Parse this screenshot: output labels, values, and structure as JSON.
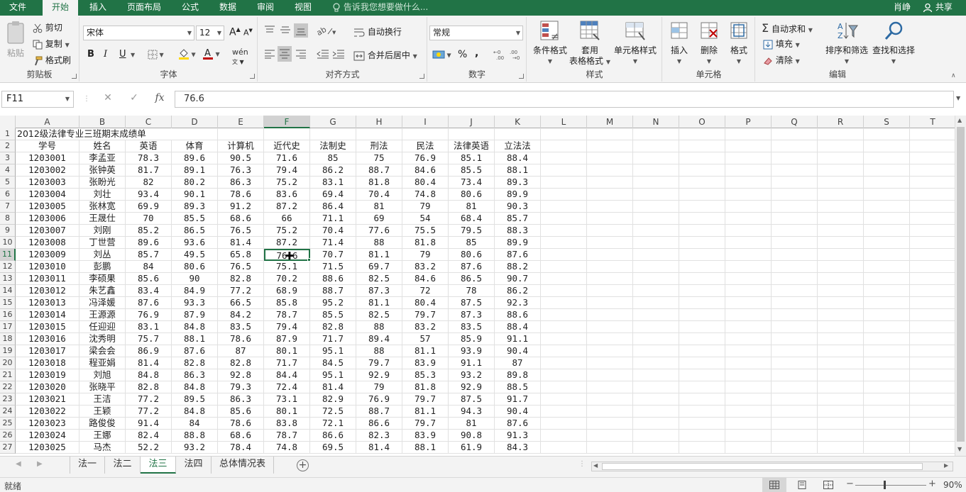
{
  "menu": {
    "tabs": [
      "文件",
      "开始",
      "插入",
      "页面布局",
      "公式",
      "数据",
      "审阅",
      "视图"
    ],
    "active": "开始",
    "tell_me": "告诉我您想要做什么...",
    "user": "肖峥",
    "share": "共享"
  },
  "ribbon": {
    "clipboard": {
      "paste": "粘贴",
      "cut": "剪切",
      "copy": "复制",
      "format_painter": "格式刷",
      "label": "剪贴板"
    },
    "font": {
      "name": "宋体",
      "size": "12",
      "label": "字体",
      "bold": "B",
      "italic": "I",
      "underline": "U",
      "grow": "A",
      "shrink": "A"
    },
    "alignment": {
      "wrap": "自动换行",
      "merge": "合并后居中",
      "label": "对齐方式"
    },
    "number": {
      "format": "常规",
      "label": "数字",
      "percent": "%",
      "comma": ","
    },
    "styles": {
      "conditional": "条件格式",
      "table_fmt_1": "套用",
      "table_fmt_2": "表格格式",
      "cell_styles": "单元格样式",
      "label": "样式"
    },
    "cells": {
      "insert": "插入",
      "delete": "删除",
      "format": "格式",
      "label": "单元格"
    },
    "editing": {
      "autosum": "自动求和",
      "fill": "填充",
      "clear": "清除",
      "sort": "排序和筛选",
      "find": "查找和选择",
      "label": "编辑"
    }
  },
  "formula_bar": {
    "name_box": "F11",
    "formula": "76.6",
    "fx": "fx"
  },
  "columns": [
    "A",
    "B",
    "C",
    "D",
    "E",
    "F",
    "G",
    "H",
    "I",
    "J",
    "K",
    "L",
    "M",
    "N",
    "O",
    "P",
    "Q",
    "R",
    "S",
    "T"
  ],
  "selected": {
    "col": "F",
    "row": 11
  },
  "sheet": {
    "title": "2012级法律专业三班期末成绩单",
    "headers": [
      "学号",
      "姓名",
      "英语",
      "体育",
      "计算机",
      "近代史",
      "法制史",
      "刑法",
      "民法",
      "法律英语",
      "立法法"
    ],
    "rows": [
      [
        "1203001",
        "李孟亚",
        "78.3",
        "89.6",
        "90.5",
        "71.6",
        "85",
        "75",
        "76.9",
        "85.1",
        "88.4"
      ],
      [
        "1203002",
        "张钟英",
        "81.7",
        "89.1",
        "76.3",
        "79.4",
        "86.2",
        "88.7",
        "84.6",
        "85.5",
        "88.1"
      ],
      [
        "1203003",
        "张盼光",
        "82",
        "80.2",
        "86.3",
        "75.2",
        "83.1",
        "81.8",
        "80.4",
        "73.4",
        "89.3"
      ],
      [
        "1203004",
        "刘壮",
        "93.4",
        "90.1",
        "78.6",
        "83.6",
        "69.4",
        "70.4",
        "74.8",
        "80.6",
        "89.9"
      ],
      [
        "1203005",
        "张林宽",
        "69.9",
        "89.3",
        "91.2",
        "87.2",
        "86.4",
        "81",
        "79",
        "81",
        "90.3"
      ],
      [
        "1203006",
        "王晟仕",
        "70",
        "85.5",
        "68.6",
        "66",
        "71.1",
        "69",
        "54",
        "68.4",
        "85.7"
      ],
      [
        "1203007",
        "刘刚",
        "85.2",
        "86.5",
        "76.5",
        "75.2",
        "70.4",
        "77.6",
        "75.5",
        "79.5",
        "88.3"
      ],
      [
        "1203008",
        "丁世营",
        "89.6",
        "93.6",
        "81.4",
        "87.2",
        "71.4",
        "88",
        "81.8",
        "85",
        "89.9"
      ],
      [
        "1203009",
        "刘丛",
        "85.7",
        "49.5",
        "65.8",
        "76.6",
        "70.7",
        "81.1",
        "79",
        "80.6",
        "87.6"
      ],
      [
        "1203010",
        "彭鹏",
        "84",
        "80.6",
        "76.5",
        "75.1",
        "71.5",
        "69.7",
        "83.2",
        "87.6",
        "88.2"
      ],
      [
        "1203011",
        "李硕果",
        "85.6",
        "90",
        "82.8",
        "70.2",
        "88.6",
        "82.5",
        "84.6",
        "86.5",
        "90.7"
      ],
      [
        "1203012",
        "朱艺鑫",
        "83.4",
        "84.9",
        "77.2",
        "68.9",
        "88.7",
        "87.3",
        "72",
        "78",
        "86.2"
      ],
      [
        "1203013",
        "冯泽媛",
        "87.6",
        "93.3",
        "66.5",
        "85.8",
        "95.2",
        "81.1",
        "80.4",
        "87.5",
        "92.3"
      ],
      [
        "1203014",
        "王源源",
        "76.9",
        "87.9",
        "84.2",
        "78.7",
        "85.5",
        "82.5",
        "79.7",
        "87.3",
        "88.6"
      ],
      [
        "1203015",
        "任迎迎",
        "83.1",
        "84.8",
        "83.5",
        "79.4",
        "82.8",
        "88",
        "83.2",
        "83.5",
        "88.4"
      ],
      [
        "1203016",
        "沈秀明",
        "75.7",
        "88.1",
        "78.6",
        "87.9",
        "71.7",
        "89.4",
        "57",
        "85.9",
        "91.1"
      ],
      [
        "1203017",
        "梁会会",
        "86.9",
        "87.6",
        "87",
        "80.1",
        "95.1",
        "88",
        "81.1",
        "93.9",
        "90.4"
      ],
      [
        "1203018",
        "程亚娟",
        "81.4",
        "82.8",
        "82.8",
        "71.7",
        "84.5",
        "79.7",
        "83.9",
        "91.1",
        "87"
      ],
      [
        "1203019",
        "刘旭",
        "84.8",
        "86.3",
        "92.8",
        "84.4",
        "95.1",
        "92.9",
        "85.3",
        "93.2",
        "89.8"
      ],
      [
        "1203020",
        "张晓平",
        "82.8",
        "84.8",
        "79.3",
        "72.4",
        "81.4",
        "79",
        "81.8",
        "92.9",
        "88.5"
      ],
      [
        "1203021",
        "王洁",
        "77.2",
        "89.5",
        "86.3",
        "73.1",
        "82.9",
        "76.9",
        "79.7",
        "87.5",
        "91.7"
      ],
      [
        "1203022",
        "王颖",
        "77.2",
        "84.8",
        "85.6",
        "80.1",
        "72.5",
        "88.7",
        "81.1",
        "94.3",
        "90.4"
      ],
      [
        "1203023",
        "路俊俊",
        "91.4",
        "84",
        "78.6",
        "83.8",
        "72.1",
        "86.6",
        "79.7",
        "81",
        "87.6"
      ],
      [
        "1203024",
        "王娜",
        "82.4",
        "88.8",
        "68.6",
        "78.7",
        "86.6",
        "82.3",
        "83.9",
        "90.8",
        "91.3"
      ],
      [
        "1203025",
        "马杰",
        "52.2",
        "93.2",
        "78.4",
        "74.8",
        "69.5",
        "81.4",
        "88.1",
        "61.9",
        "84.3"
      ]
    ]
  },
  "sheet_tabs": [
    "法一",
    "法二",
    "法三",
    "法四",
    "总体情况表"
  ],
  "active_tab": "法三",
  "status": {
    "ready": "就绪",
    "zoom": "90%"
  }
}
